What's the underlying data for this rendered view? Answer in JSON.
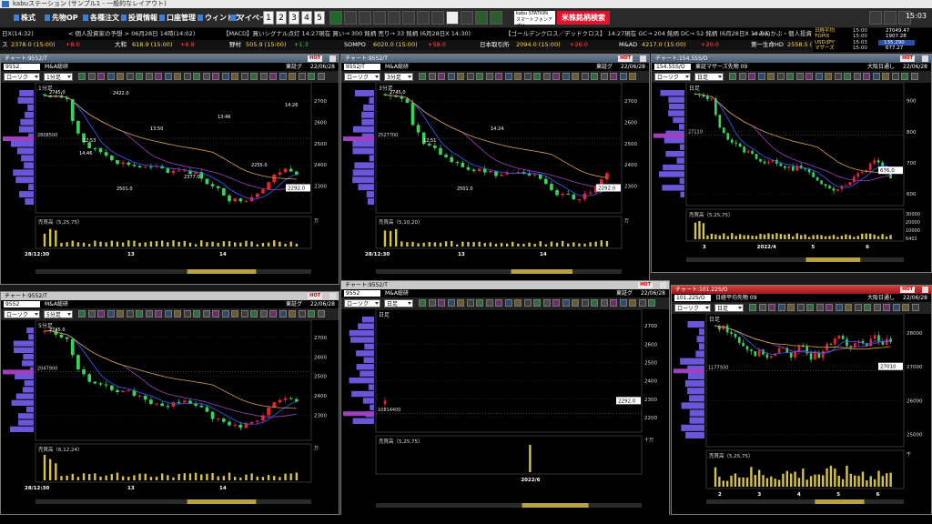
{
  "window_title": "kabuステーション (サンプル1 - 一般的なレイアウト)",
  "menu": {
    "stocks": "株式",
    "futures_op": "先物OP",
    "orders": "各種注文",
    "investment_info": "投資情報",
    "account": "口座管理",
    "window": "ウィンドウ",
    "mypage": "マイページ",
    "layouts": [
      "1",
      "2",
      "3",
      "4",
      "5"
    ],
    "kabu_station_app_line1": "kabu STATION",
    "kabu_station_app_line2": "スマートフォンアプリ",
    "search_label": "米株銘柄検索",
    "clock": "15:03"
  },
  "ticker_top": [
    {
      "text": "日X(14:32)",
      "color": "#ddd"
    },
    {
      "text": "< 個人投資家の予想 > 06月28日 14時(14:02)",
      "color": "#ddd"
    },
    {
      "text": "【MACD】買いシグナル点灯 14:27現在 買い→ 300 銘柄 売り→ 33 銘柄 (6月28日X 14:30)",
      "color": "#ddd"
    },
    {
      "text": "【ゴールデンクロス／デッドクロス】 14:27現在 GC→ 204 銘柄 DC→ 52 銘柄 (6月28日X 14:00)",
      "color": "#ddd"
    },
    {
      "text": "< みんかぶ・個人投資",
      "color": "#ddd"
    }
  ],
  "ticker_bottom": [
    {
      "name": "ス",
      "price": "2378.0 (15:00)",
      "chg": "+8.0"
    },
    {
      "name": "大和",
      "price": "618.9 (15:00)",
      "chg": "+6.8"
    },
    {
      "name": "野村",
      "price": "505.9 (15:00)",
      "chg": "+1.3"
    },
    {
      "name": "SOMPO",
      "price": "6020.0 (15:00)",
      "chg": "+58.0"
    },
    {
      "name": "日本取引所",
      "price": "2094.0 (15:00)",
      "chg": "+26.0"
    },
    {
      "name": "M&AD",
      "price": "4217.0 (15:00)",
      "chg": "+20.0"
    },
    {
      "name": "第一生命HD",
      "price": "2558.5 (15:00)",
      "chg": ""
    }
  ],
  "market": [
    {
      "name": "日経平均",
      "time": "15:00",
      "value": "27049.47",
      "box": false
    },
    {
      "name": "TOPIX",
      "time": "15:00",
      "value": "1907.28",
      "box": false
    },
    {
      "name": "USD/JPY",
      "time": "15:03",
      "value": "135.290",
      "box": true
    },
    {
      "name": "マザーズ",
      "time": "15:00",
      "value": "677.27",
      "box": false
    }
  ],
  "charts": [
    {
      "id": "c1",
      "title": "チャート:9552/T",
      "hot": "HOT",
      "code": "9552",
      "name": "M&A総研",
      "market": "東証グ",
      "date": "22/06/28",
      "ctrl1": "ローソク",
      "ctrl2": "1分足",
      "period_label": "1分足",
      "price_label": "2292.0",
      "mv_label": "2808500",
      "vol_label": "売買高（5,25,75）",
      "vol_unit": "万",
      "x_labels": [
        "28/12:30",
        "13",
        "14"
      ],
      "annotations": [
        "2745.0",
        "12:53",
        "2501.0",
        "13:50",
        "2377.0",
        "13:46",
        "2255.0",
        "14:26",
        "14:46",
        "2422.0"
      ],
      "chart_data": {
        "type": "candlestick",
        "ylim": [
          2200,
          2760
        ],
        "y_ticks": [
          2700,
          2600,
          2500,
          2400,
          2300
        ],
        "last": 2292.0,
        "high": 2745.0,
        "low": 2255.0,
        "vol_ticks": []
      }
    },
    {
      "id": "c2",
      "title": "チャート:9552/T",
      "hot": "HOT",
      "code": "9552/T",
      "name": "M&A総研",
      "market": "東証グ",
      "date": "22/06/28",
      "ctrl1": "ローソク",
      "ctrl2": "3分足",
      "period_label": "3分足",
      "price_label": "2292.0",
      "mv_label": "2527700",
      "vol_label": "売買高（5,10,20）",
      "vol_unit": "万",
      "x_labels": [
        "28/12:30",
        "13",
        "14"
      ],
      "annotations": [
        "2745.0",
        "12:51",
        "2501.0",
        "14:24"
      ],
      "chart_data": {
        "type": "candlestick",
        "ylim": [
          2200,
          2760
        ],
        "y_ticks": [
          2700,
          2600,
          2500,
          2400,
          2300
        ],
        "last": 2292.0,
        "high": 2745.0,
        "low": 2255.0,
        "vol_ticks": []
      }
    },
    {
      "id": "c3",
      "title": "チャート:154.55S/O",
      "hot": "HOT",
      "code": "154.55S/O",
      "name": "東証マザーズ先物 09",
      "market": "大阪日通し",
      "date": "22/06/28",
      "ctrl1": "ローソク",
      "ctrl2": "日足",
      "period_label": "日足",
      "price_label": "676.0",
      "mv_label": "27110",
      "vol_label": "売買高（5,25,75）",
      "vol_unit": "",
      "x_labels": [
        "3",
        "2022/4",
        "5",
        "6"
      ],
      "annotations": [],
      "chart_data": {
        "type": "candlestick",
        "ylim": [
          580,
          940
        ],
        "y_ticks": [
          900,
          800,
          700,
          600
        ],
        "last": 676.0,
        "vol_ticks": [
          "30000",
          "20000",
          "10000",
          "6402"
        ]
      }
    },
    {
      "id": "c4",
      "title": "チャート:9552/T",
      "hot": "HOT",
      "code": "9552",
      "name": "M&A総研",
      "market": "東証グ",
      "date": "22/06/28",
      "ctrl1": "ローソク",
      "ctrl2": "5分足",
      "period_label": "5分足",
      "price_label": "",
      "mv_label": "2047900",
      "vol_label": "売買高（6,12,24）",
      "vol_unit": "万",
      "x_labels": [
        "28/12:30",
        "13",
        "14"
      ],
      "annotations": [
        "2745.0"
      ],
      "chart_data": {
        "type": "candlestick",
        "ylim": [
          2200,
          2760
        ],
        "y_ticks": [
          2700,
          2600,
          2500,
          2400,
          2300
        ],
        "last": 2292.0,
        "high": 2745.0,
        "vol_ticks": []
      }
    },
    {
      "id": "c5",
      "title": "チャート:9552/T",
      "hot": "HOT",
      "code": "9552",
      "name": "M&A総研",
      "market": "東証グ",
      "date": "22/06/28",
      "ctrl1": "ローソク",
      "ctrl2": "日足",
      "period_label": "日足",
      "price_label": "2292.0",
      "mv_label": "10814400",
      "vol_label": "売買高（5,25,75）",
      "vol_unit": "十万",
      "x_labels": [
        "2022/6"
      ],
      "annotations": [],
      "chart_data": {
        "type": "candlestick",
        "ylim": [
          2150,
          2760
        ],
        "y_ticks": [
          2700,
          2600,
          2500,
          2400,
          2300,
          2200
        ],
        "last": 2292.0,
        "vol_ticks": []
      }
    },
    {
      "id": "c6",
      "title": "チャート:101.22S/O",
      "hot": "HOT",
      "code": "101.22S/O",
      "name": "日経平均先物 09",
      "market": "大阪日通し",
      "date": "22/06/28",
      "ctrl1": "ローソク",
      "ctrl2": "日足",
      "period_label": "日足",
      "price_label": "27010",
      "mv_label": "1177930",
      "vol_label": "売買高（5,25,75）",
      "vol_unit": "千",
      "x_labels": [
        "2",
        "3",
        "4",
        "5",
        "6"
      ],
      "annotations": [],
      "chart_data": {
        "type": "candlestick",
        "ylim": [
          24800,
          28400
        ],
        "y_ticks": [
          28000,
          27000,
          26000,
          25000
        ],
        "last": 27010,
        "vol_ticks": []
      }
    }
  ]
}
